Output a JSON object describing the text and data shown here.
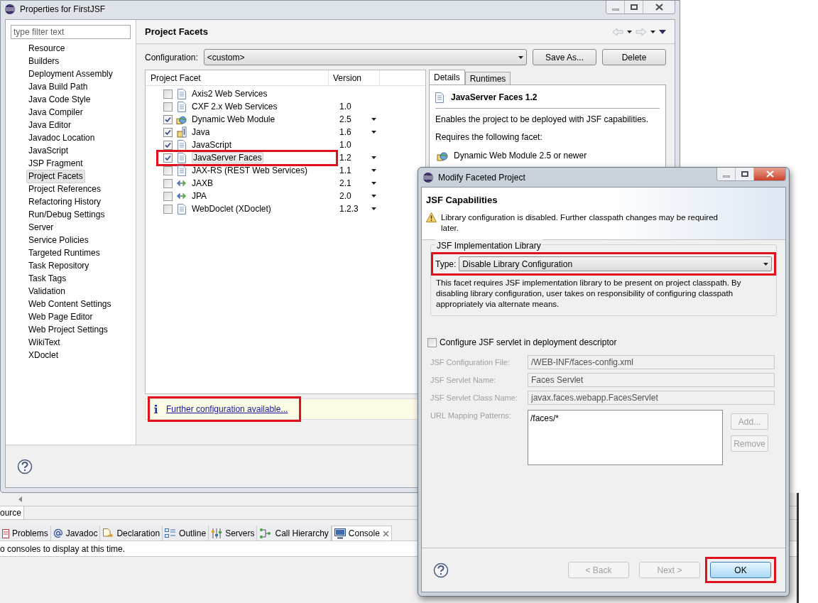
{
  "window": {
    "title": "Properties for FirstJSF"
  },
  "filter": {
    "placeholder": "type filter text"
  },
  "sidebar": {
    "items": [
      {
        "label": "Resource",
        "selected": false
      },
      {
        "label": "Builders",
        "selected": false
      },
      {
        "label": "Deployment Assembly",
        "selected": false
      },
      {
        "label": "Java Build Path",
        "selected": false
      },
      {
        "label": "Java Code Style",
        "selected": false
      },
      {
        "label": "Java Compiler",
        "selected": false
      },
      {
        "label": "Java Editor",
        "selected": false
      },
      {
        "label": "Javadoc Location",
        "selected": false
      },
      {
        "label": "JavaScript",
        "selected": false
      },
      {
        "label": "JSP Fragment",
        "selected": false
      },
      {
        "label": "Project Facets",
        "selected": true
      },
      {
        "label": "Project References",
        "selected": false
      },
      {
        "label": "Refactoring History",
        "selected": false
      },
      {
        "label": "Run/Debug Settings",
        "selected": false
      },
      {
        "label": "Server",
        "selected": false
      },
      {
        "label": "Service Policies",
        "selected": false
      },
      {
        "label": "Targeted Runtimes",
        "selected": false
      },
      {
        "label": "Task Repository",
        "selected": false
      },
      {
        "label": "Task Tags",
        "selected": false
      },
      {
        "label": "Validation",
        "selected": false
      },
      {
        "label": "Web Content Settings",
        "selected": false
      },
      {
        "label": "Web Page Editor",
        "selected": false
      },
      {
        "label": "Web Project Settings",
        "selected": false
      },
      {
        "label": "WikiText",
        "selected": false
      },
      {
        "label": "XDoclet",
        "selected": false
      }
    ]
  },
  "page": {
    "title": "Project Facets",
    "configuration_label": "Configuration:",
    "configuration_value": "<custom>",
    "buttons": [
      "Save As...",
      "Delete"
    ]
  },
  "facets_table": {
    "columns": [
      "Project Facet",
      "Version"
    ],
    "rows": [
      {
        "name": "Axis2 Web Services",
        "kind": "document",
        "checked": false,
        "has_dropdown": false,
        "selected": false,
        "highlighted": false
      },
      {
        "name": "CXF 2.x Web Services",
        "version": "1.0",
        "kind": "document",
        "checked": false,
        "has_dropdown": false,
        "selected": false,
        "highlighted": false
      },
      {
        "name": "Dynamic Web Module",
        "version": "2.5",
        "kind": "module",
        "checked": true,
        "has_dropdown": true,
        "selected": false,
        "highlighted": false
      },
      {
        "name": "Java",
        "version": "1.6",
        "kind": "library",
        "checked": true,
        "has_dropdown": true,
        "selected": false,
        "highlighted": false
      },
      {
        "name": "JavaScript",
        "version": "1.0",
        "kind": "document",
        "checked": true,
        "has_dropdown": false,
        "selected": false,
        "highlighted": false
      },
      {
        "name": "JavaServer Faces",
        "version": "1.2",
        "kind": "document",
        "checked": true,
        "has_dropdown": true,
        "selected": true,
        "highlighted": true
      },
      {
        "name": "JAX-RS (REST Web Services)",
        "version": "1.1",
        "kind": "document",
        "checked": false,
        "has_dropdown": true,
        "selected": false,
        "highlighted": false
      },
      {
        "name": "JAXB",
        "version": "2.1",
        "kind": "binding",
        "checked": false,
        "has_dropdown": true,
        "selected": false,
        "highlighted": false
      },
      {
        "name": "JPA",
        "version": "2.0",
        "kind": "binding",
        "checked": false,
        "has_dropdown": true,
        "selected": false,
        "highlighted": false
      },
      {
        "name": "WebDoclet (XDoclet)",
        "version": "1.2.3",
        "kind": "document",
        "checked": false,
        "has_dropdown": true,
        "selected": false,
        "highlighted": false
      }
    ]
  },
  "details": {
    "tabs": [
      {
        "label": "Details",
        "selected": true
      },
      {
        "label": "Runtimes",
        "selected": false
      }
    ],
    "title": "JavaServer Faces 1.2",
    "description": "Enables the project to be deployed with JSF capabilities.",
    "requires_label": "Requires the following facet:",
    "requirements": [
      "Dynamic Web Module 2.5 or newer"
    ]
  },
  "info_bar": {
    "link": "Further configuration available...",
    "highlighted": true
  },
  "workbench": {
    "editor_tab": "ource",
    "views": [
      {
        "label": "Problems",
        "selected": false
      },
      {
        "label": "Javadoc",
        "selected": false
      },
      {
        "label": "Declaration",
        "selected": false
      },
      {
        "label": "Outline",
        "selected": false
      },
      {
        "label": "Servers",
        "selected": false
      },
      {
        "label": "Call Hierarchy",
        "selected": false
      },
      {
        "label": "Console",
        "selected": true
      }
    ],
    "console_message": "o consoles to display at this time."
  },
  "dialog": {
    "title": "Modify Faceted Project",
    "heading": "JSF Capabilities",
    "message": "Library configuration is disabled. Further classpath changes may be required later.",
    "group": {
      "label": "JSF Implementation Library",
      "type_label": "Type:",
      "type_value": "Disable Library Configuration",
      "highlighted": true,
      "description": "This facet requires JSF implementation library to be present on project classpath. By disabling library configuration, user takes on responsibility of configuring classpath appropriately via alternate means."
    },
    "servlet_checkbox": {
      "label": "Configure JSF servlet in deployment descriptor",
      "checked": false
    },
    "fields": [
      {
        "label": "JSF Configuration File:",
        "value": "/WEB-INF/faces-config.xml",
        "disabled": true
      },
      {
        "label": "JSF Servlet Name:",
        "value": "Faces Servlet",
        "disabled": true
      },
      {
        "label": "JSF Servlet Class Name:",
        "value": "javax.faces.webapp.FacesServlet",
        "disabled": true
      }
    ],
    "url_patterns": {
      "label": "URL Mapping Patterns:",
      "items": [
        "/faces/*"
      ],
      "disabled": true
    },
    "side_buttons": [
      {
        "label": "Add...",
        "disabled": true
      },
      {
        "label": "Remove",
        "disabled": true
      }
    ],
    "buttons": [
      {
        "label": "< Back",
        "disabled": true,
        "default": false,
        "highlighted": false
      },
      {
        "label": "Next >",
        "disabled": true,
        "default": false,
        "highlighted": false
      },
      {
        "label": "OK",
        "disabled": false,
        "default": true,
        "highlighted": true
      }
    ]
  }
}
